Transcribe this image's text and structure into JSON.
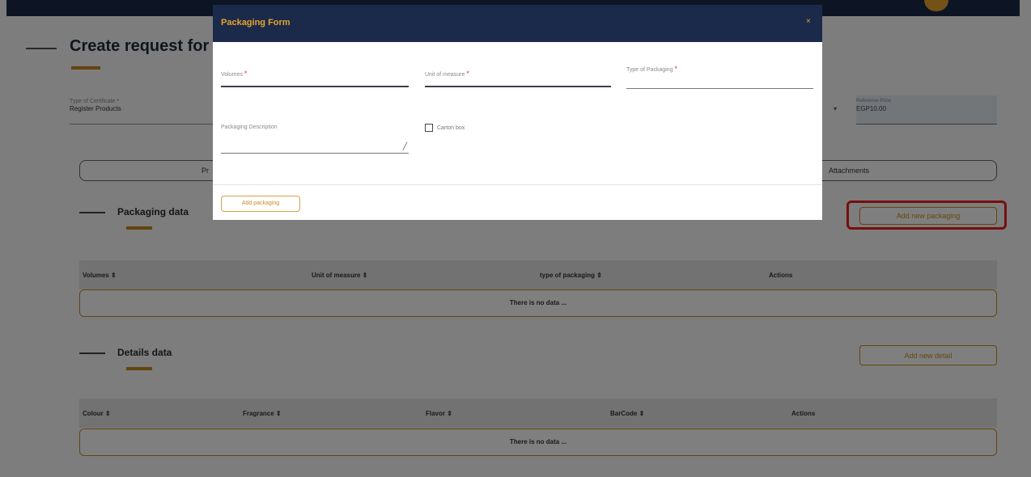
{
  "page": {
    "title": "Create request for",
    "certificate_type": {
      "label": "Type of Certificate",
      "required_mark": "*",
      "value": "Register Products"
    },
    "reference": {
      "label": "Reference Price",
      "value": "EGP10.00"
    },
    "tabs": {
      "first_fragment": "Pr",
      "attachments": "Attachments"
    }
  },
  "packaging_section": {
    "title": "Packaging data",
    "add_button": "Add new packaging",
    "columns": [
      "Volumes ⇕",
      "Unit of measure ⇕",
      "type of packaging ⇕",
      "Actions"
    ],
    "empty_text": "There is no data ..."
  },
  "details_section": {
    "title": "Details data",
    "add_button": "Add new detail",
    "columns": [
      "Colour ⇕",
      "Fragrance ⇕",
      "Flavor ⇕",
      "BarCode ⇕",
      "Actions"
    ],
    "empty_text": "There is no data ..."
  },
  "modal": {
    "title": "Packaging Form",
    "close": "×",
    "fields": {
      "volumes": {
        "label": "Volumes",
        "required_mark": "*"
      },
      "unit": {
        "label": "Unit of measure",
        "required_mark": "*"
      },
      "type": {
        "label": "Type of Packaging",
        "required_mark": "*"
      },
      "description": {
        "label": "Packaging Description",
        "resize_glyph": "╱"
      }
    },
    "carton_label": "Carton box",
    "add_button": "Add packaging"
  },
  "colors": {
    "navy": "#1b2a4a",
    "accent": "#c98a1f",
    "highlight": "#ee1c1c"
  }
}
